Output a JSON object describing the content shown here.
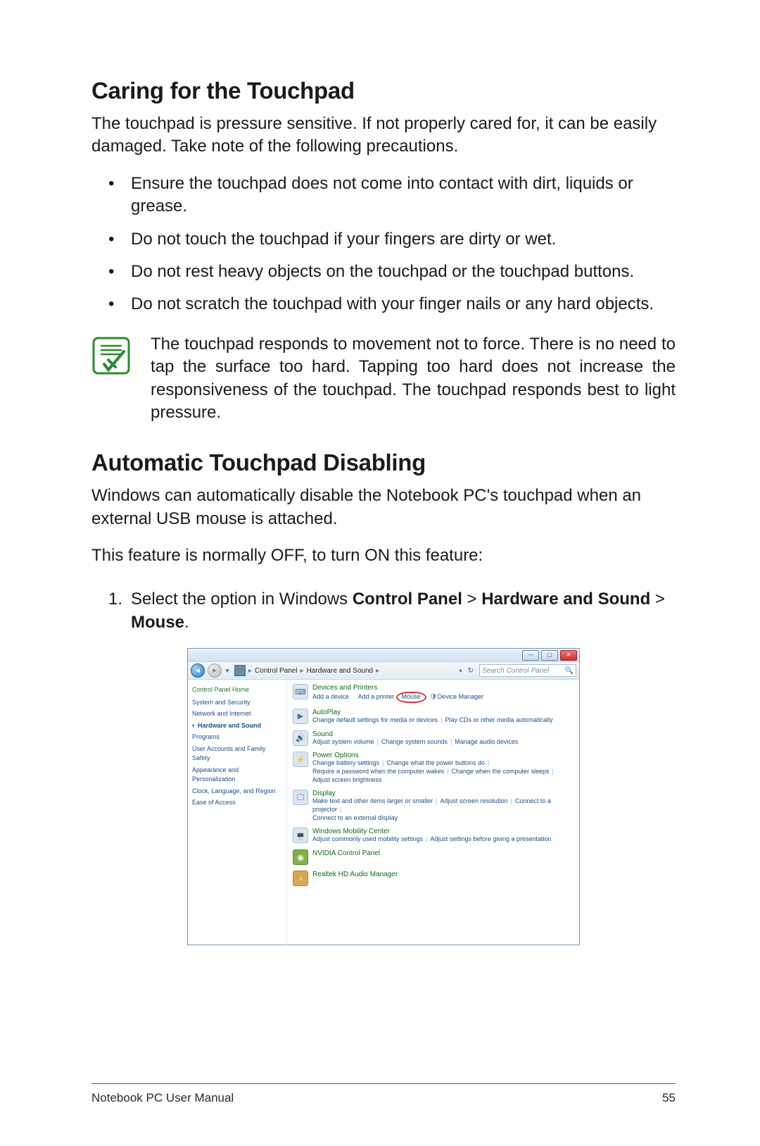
{
  "section1": {
    "heading": "Caring for the Touchpad",
    "intro": "The touchpad is pressure sensitive. If not properly cared for, it can be easily damaged. Take note of the following precautions.",
    "bullets": [
      "Ensure the touchpad does not come into contact with dirt, liquids or grease.",
      "Do not touch the touchpad if your fingers are dirty or wet.",
      "Do not rest heavy objects on the touchpad or the touchpad buttons.",
      "Do not scratch the touchpad with your finger nails or any hard objects."
    ],
    "note": "The touchpad responds to movement not to force. There is no need to tap the surface too hard. Tapping too hard does not increase the responsiveness of the touchpad. The touchpad responds best to light pressure."
  },
  "section2": {
    "heading": "Automatic Touchpad Disabling",
    "p1": "Windows can automatically disable the Notebook PC's touchpad when an external USB mouse is attached.",
    "p2": "This feature is normally OFF, to turn ON this feature:",
    "step_num": "1.",
    "step_lead": "Select the option in Windows ",
    "step_b1": "Control Panel",
    "step_gt1": " > ",
    "step_b2": "Hardware and Sound",
    "step_gt2": " > ",
    "step_b3": "Mouse",
    "step_end": "."
  },
  "screenshot": {
    "breadcrumbs": {
      "root": "Control Panel",
      "sub": "Hardware and Sound"
    },
    "search_placeholder": "Search Control Panel",
    "sidebar": {
      "home": "Control Panel Home",
      "items": [
        "System and Security",
        "Network and Internet",
        "Hardware and Sound",
        "Programs",
        "User Accounts and Family Safety",
        "Appearance and Personalization",
        "Clock, Language, and Region",
        "Ease of Access"
      ],
      "active_index": 2
    },
    "main": {
      "devices": {
        "title": "Devices and Printers",
        "add_device": "Add a device",
        "add_printer": "Add a printer",
        "mouse": "Mouse",
        "device_manager": "Device Manager"
      },
      "autoplay": {
        "title": "AutoPlay",
        "line": "Change default settings for media or devices",
        "line2": "Play CDs or other media automatically"
      },
      "sound": {
        "title": "Sound",
        "a": "Adjust system volume",
        "b": "Change system sounds",
        "c": "Manage audio devices"
      },
      "power": {
        "title": "Power Options",
        "a": "Change battery settings",
        "b": "Change what the power buttons do",
        "c": "Require a password when the computer wakes",
        "d": "Change when the computer sleeps",
        "e": "Adjust screen brightness"
      },
      "display": {
        "title": "Display",
        "a": "Make text and other items larger or smaller",
        "b": "Adjust screen resolution",
        "c": "Connect to a projector",
        "d": "Connect to an external display"
      },
      "mobility": {
        "title": "Windows Mobility Center",
        "a": "Adjust commonly used mobility settings",
        "b": "Adjust settings before giving a presentation"
      },
      "nvidia": {
        "title": "NVIDIA Control Panel"
      },
      "realtek": {
        "title": "Realtek HD Audio Manager"
      }
    }
  },
  "footer": {
    "left": "Notebook PC User Manual",
    "right": "55"
  }
}
